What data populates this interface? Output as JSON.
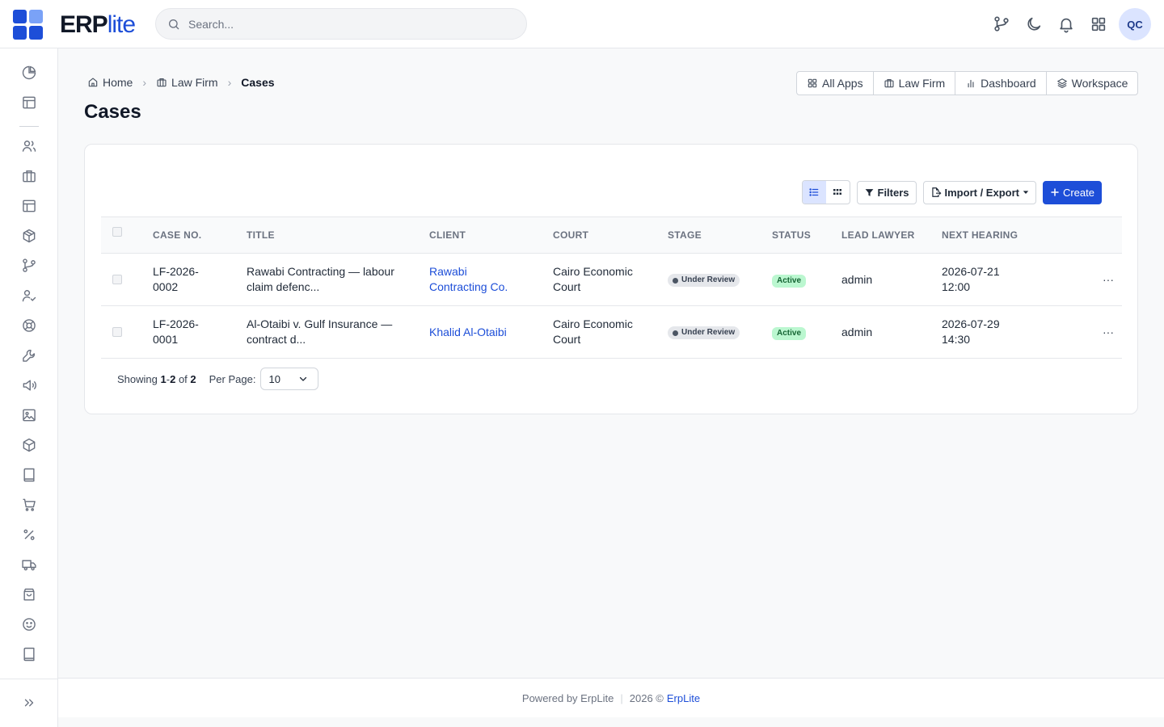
{
  "header": {
    "logo_text_bold": "ERP",
    "logo_text_light": "lite",
    "search_placeholder": "Search...",
    "avatar_initials": "QC"
  },
  "breadcrumb": {
    "home": "Home",
    "module": "Law Firm",
    "current": "Cases"
  },
  "page_title": "Cases",
  "app_nav": [
    "All Apps",
    "Law Firm",
    "Dashboard",
    "Workspace"
  ],
  "toolbar": {
    "filters_label": "Filters",
    "import_export_label": "Import / Export",
    "create_label": "Create"
  },
  "table": {
    "columns": [
      "CASE NO.",
      "TITLE",
      "CLIENT",
      "COURT",
      "STAGE",
      "STATUS",
      "LEAD LAWYER",
      "NEXT HEARING"
    ],
    "rows": [
      {
        "case_no": "LF-2026-0002",
        "title": "Rawabi Contracting — labour claim defenc...",
        "client": "Rawabi Contracting Co.",
        "court": "Cairo Economic Court",
        "stage": "Under Review",
        "status": "Active",
        "lead_lawyer": "admin",
        "next_hearing": "2026-07-21 12:00"
      },
      {
        "case_no": "LF-2026-0001",
        "title": "Al-Otaibi v. Gulf Insurance — contract d...",
        "client": "Khalid Al-Otaibi",
        "court": "Cairo Economic Court",
        "stage": "Under Review",
        "status": "Active",
        "lead_lawyer": "admin",
        "next_hearing": "2026-07-29 14:30"
      }
    ]
  },
  "pagination": {
    "showing_label": "Showing",
    "range_start": "1",
    "range_end": "2",
    "of_label": "of",
    "total": "2",
    "per_page_label": "Per Page:",
    "per_page_value": "10"
  },
  "footer": {
    "powered_by": "Powered by ErpLite",
    "year_text": "2026 ©",
    "brand_link": "ErpLite"
  },
  "colors": {
    "accent": "#1d4ed8",
    "status_active_bg": "#bbf7d0",
    "status_active_text": "#166534"
  }
}
